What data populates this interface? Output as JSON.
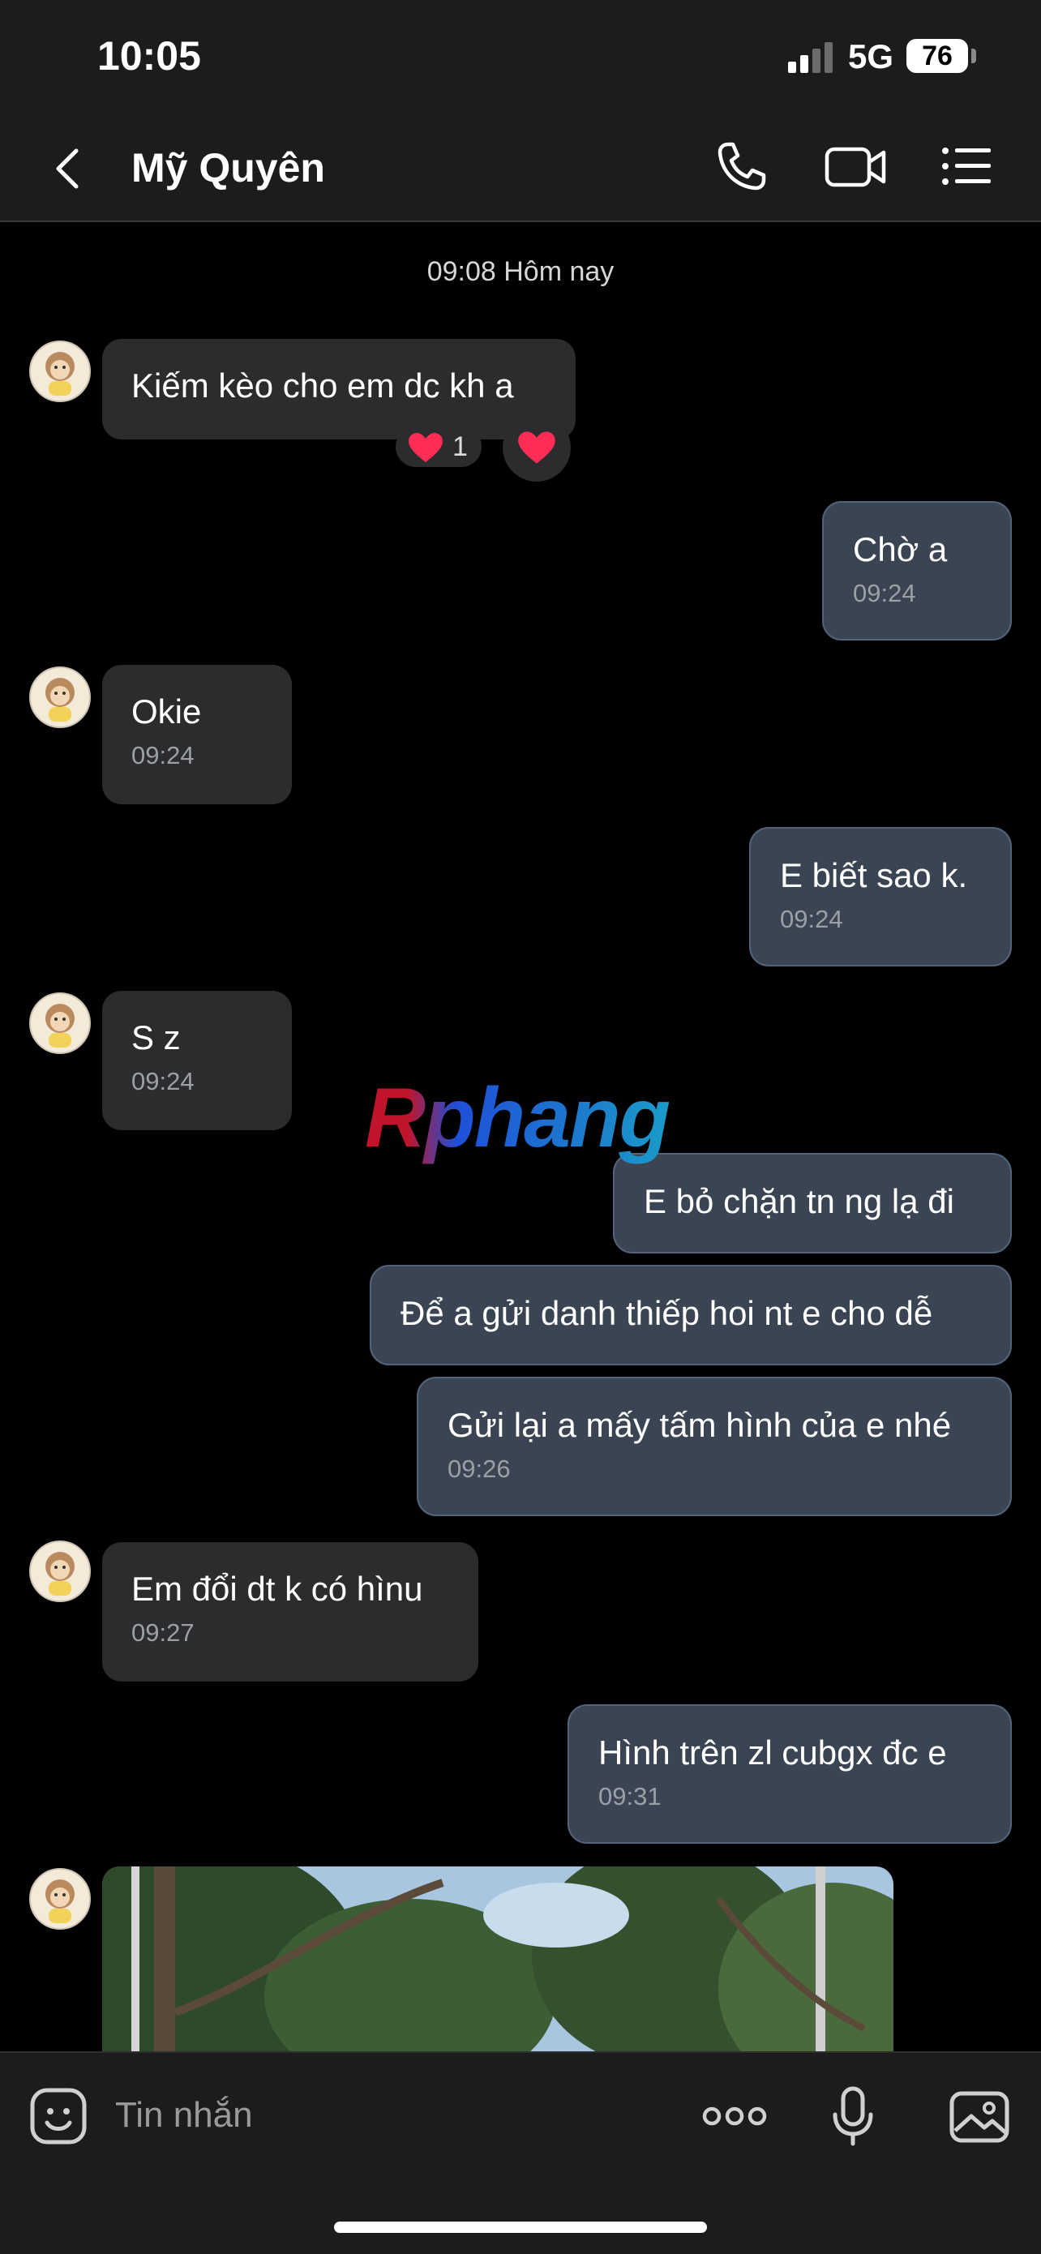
{
  "status_bar": {
    "time": "10:05",
    "network": "5G",
    "battery": "76"
  },
  "header": {
    "contact_name": "Mỹ Quyên"
  },
  "chat": {
    "date_separator": "09:08 Hôm nay",
    "messages": [
      {
        "side": "received",
        "text": "Kiếm kèo cho em dc kh a",
        "reaction_count": "1"
      },
      {
        "side": "sent",
        "text": "Chờ a",
        "time": "09:24"
      },
      {
        "side": "received",
        "text": "Okie",
        "time": "09:24"
      },
      {
        "side": "sent",
        "text": "E biết sao k.",
        "time": "09:24"
      },
      {
        "side": "received",
        "text": "S z",
        "time": "09:24"
      },
      {
        "side": "sent",
        "text": "E bỏ chặn tn ng lạ đi"
      },
      {
        "side": "sent",
        "text": "Để a gửi danh thiếp hoi nt e cho dễ"
      },
      {
        "side": "sent",
        "text": "Gửi lại a mấy tấm hình của e nhé",
        "time": "09:26"
      },
      {
        "side": "received",
        "text": "Em đổi dt k có hìnu",
        "time": "09:27"
      },
      {
        "side": "sent",
        "text": "Hình trên zl cubgx đc e",
        "time": "09:31"
      }
    ]
  },
  "watermark": "Rphang",
  "composer": {
    "placeholder": "Tin nhắn"
  },
  "colors": {
    "background": "#000000",
    "bar": "#1c1c1c",
    "received_bubble": "#2c2c2e",
    "sent_bubble": "#3a4452",
    "heart": "#ff2d55"
  }
}
